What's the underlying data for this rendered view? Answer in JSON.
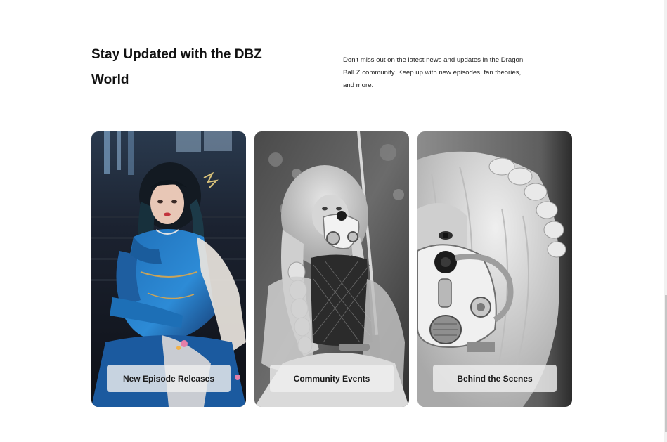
{
  "section": {
    "title": "Stay Updated with the DBZ World",
    "description": "Don't miss out on the latest news and updates in the Dragon Ball Z community. Keep up with new episodes, fan theories, and more."
  },
  "cards": [
    {
      "label": "New Episode Releases",
      "image": "cosplayer in blue costume photo"
    },
    {
      "label": "Community Events",
      "image": "cosplayer with gas mask and sword photo"
    },
    {
      "label": "Behind the Scenes",
      "image": "close-up cosplayer with gas mask photo"
    }
  ],
  "colors": {
    "background": "#ffffff",
    "heading": "#111111",
    "label_bg": "#eeeeee"
  }
}
